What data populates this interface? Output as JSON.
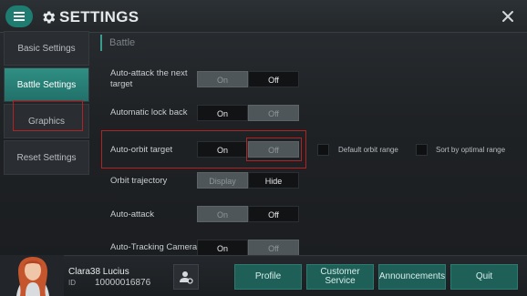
{
  "header": {
    "title": "SETTINGS"
  },
  "sidebar": {
    "items": [
      {
        "label": "Basic Settings",
        "active": false
      },
      {
        "label": "Battle Settings",
        "active": true
      },
      {
        "label": "Graphics",
        "active": false
      },
      {
        "label": "Reset Settings",
        "active": false
      }
    ]
  },
  "content": {
    "section_title": "Battle",
    "rows": [
      {
        "label": "Auto-attack the next target",
        "options": [
          "On",
          "Off"
        ],
        "selected": "On"
      },
      {
        "label": "Automatic lock back",
        "options": [
          "On",
          "Off"
        ],
        "selected": "Off"
      },
      {
        "label": "Auto-orbit target",
        "options": [
          "On",
          "Off"
        ],
        "selected": "Off"
      },
      {
        "label": "Orbit trajectory",
        "options": [
          "Display",
          "Hide"
        ],
        "selected": "Display"
      },
      {
        "label": "Auto-attack",
        "options": [
          "On",
          "Off"
        ],
        "selected": "On"
      },
      {
        "label": "Auto-Tracking Camera",
        "options": [
          "On",
          "Off"
        ],
        "selected": "Off"
      }
    ],
    "orbit_options": {
      "default_range": "Default orbit range",
      "optimal_range": "Sort by optimal range"
    }
  },
  "footer": {
    "player_name": "Clara38 Lucius",
    "id_label": "ID",
    "player_id": "10000016876",
    "buttons": [
      "Profile",
      "Customer Service",
      "Announcements",
      "Quit"
    ]
  },
  "colors": {
    "accent": "#2f8f83",
    "highlight": "#b32222"
  }
}
